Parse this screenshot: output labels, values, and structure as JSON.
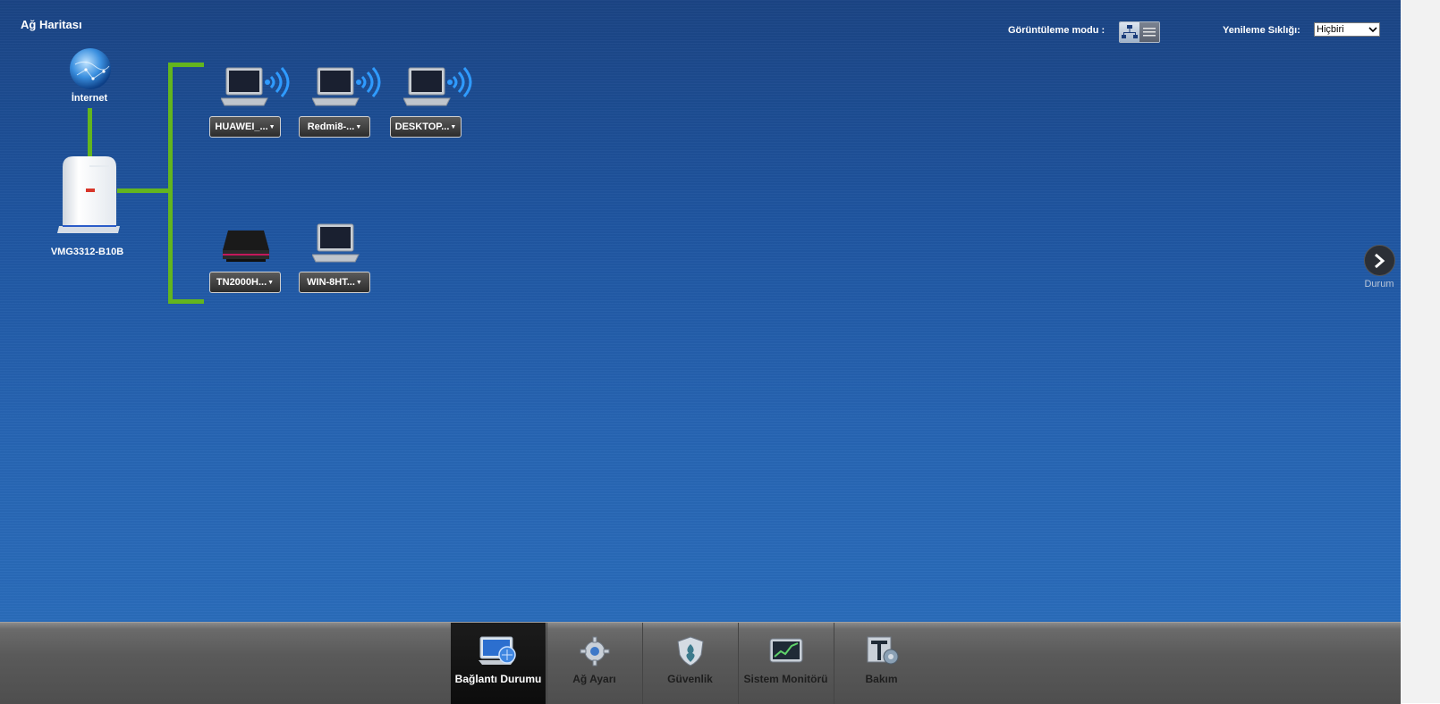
{
  "page": {
    "title": "Ağ Haritası"
  },
  "controls": {
    "view_mode_label": "Görüntüleme modu :",
    "refresh_label": "Yenileme Sıklığı:",
    "refresh_value": "Hiçbiri"
  },
  "network": {
    "internet_label": "İnternet",
    "router_label": "VMG3312-B10B",
    "wireless_devices": [
      "HUAWEI_...",
      "Redmi8-...",
      "DESKTOP..."
    ],
    "wired_devices": [
      "TN2000H...",
      "WIN-8HT..."
    ]
  },
  "side_nav": {
    "label": "Durum",
    "icon": "chevron-right-icon"
  },
  "footer_tabs": [
    {
      "label": "Bağlantı Durumu",
      "icon": "connection-status-icon",
      "active": true
    },
    {
      "label": "Ağ Ayarı",
      "icon": "gear-icon",
      "active": false
    },
    {
      "label": "Güvenlik",
      "icon": "shield-icon",
      "active": false
    },
    {
      "label": "Sistem Monitörü",
      "icon": "monitor-chart-icon",
      "active": false
    },
    {
      "label": "Bakım",
      "icon": "maintenance-icon",
      "active": false
    }
  ],
  "colors": {
    "link_line": "#63b51e",
    "background": "#1f55a0",
    "footer": "#5a5a5a"
  }
}
